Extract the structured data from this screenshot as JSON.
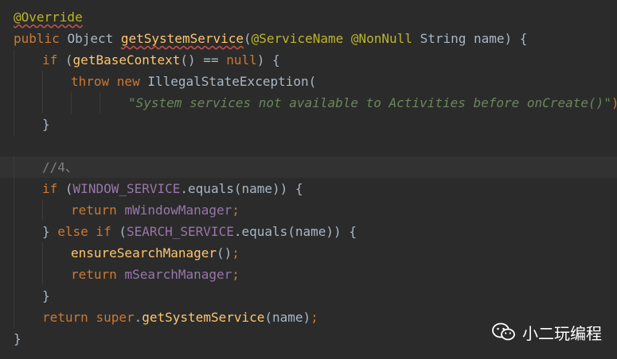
{
  "editor": {
    "lines": [
      {
        "tokens": [
          {
            "t": "@Override",
            "c": "t-annot warn"
          }
        ]
      },
      {
        "tokens": [
          {
            "t": "public ",
            "c": "t-kw"
          },
          {
            "t": "Object "
          },
          {
            "t": "getSystemService",
            "c": "t-method warn"
          },
          {
            "t": "("
          },
          {
            "t": "@ServiceName ",
            "c": "t-annot"
          },
          {
            "t": "@NonNull ",
            "c": "t-annot"
          },
          {
            "t": "String name) {"
          }
        ]
      },
      {
        "indent": 1,
        "tokens": [
          {
            "t": "if ",
            "c": "t-kw"
          },
          {
            "t": "("
          },
          {
            "t": "getBaseContext",
            "c": "t-method"
          },
          {
            "t": "() == "
          },
          {
            "t": "null",
            "c": "t-null"
          },
          {
            "t": ") {"
          }
        ]
      },
      {
        "indent": 2,
        "tokens": [
          {
            "t": "throw new ",
            "c": "t-kw"
          },
          {
            "t": "IllegalStateException("
          }
        ]
      },
      {
        "indent": 4,
        "tokens": [
          {
            "t": "\"System services not available to Activities before onCreate()\"",
            "c": "t-str"
          },
          {
            "t": ");",
            "c": "t-kw"
          }
        ]
      },
      {
        "indent": 1,
        "tokens": [
          {
            "t": "}"
          }
        ]
      },
      {
        "tokens": []
      },
      {
        "indent": 1,
        "current": true,
        "tokens": [
          {
            "t": "//4、",
            "c": "t-comment"
          }
        ]
      },
      {
        "indent": 1,
        "tokens": [
          {
            "t": "if ",
            "c": "t-kw"
          },
          {
            "t": "("
          },
          {
            "t": "WINDOW_SERVICE",
            "c": "t-field"
          },
          {
            "t": ".equals(name)) {"
          }
        ]
      },
      {
        "indent": 2,
        "tokens": [
          {
            "t": "return ",
            "c": "t-kw"
          },
          {
            "t": "mWindowManager",
            "c": "t-field"
          },
          {
            "t": ";",
            "c": "t-kw"
          }
        ]
      },
      {
        "indent": 1,
        "tokens": [
          {
            "t": "} "
          },
          {
            "t": "else if ",
            "c": "t-kw"
          },
          {
            "t": "("
          },
          {
            "t": "SEARCH_SERVICE",
            "c": "t-field"
          },
          {
            "t": ".equals(name)) {"
          }
        ]
      },
      {
        "indent": 2,
        "tokens": [
          {
            "t": "ensureSearchManager",
            "c": "t-method"
          },
          {
            "t": "()"
          },
          {
            "t": ";",
            "c": "t-kw"
          }
        ]
      },
      {
        "indent": 2,
        "tokens": [
          {
            "t": "return ",
            "c": "t-kw"
          },
          {
            "t": "mSearchManager",
            "c": "t-field"
          },
          {
            "t": ";",
            "c": "t-kw"
          }
        ]
      },
      {
        "indent": 1,
        "tokens": [
          {
            "t": "}"
          }
        ]
      },
      {
        "indent": 1,
        "tokens": [
          {
            "t": "return ",
            "c": "t-kw"
          },
          {
            "t": "super",
            "c": "t-kw"
          },
          {
            "t": "."
          },
          {
            "t": "getSystemService",
            "c": "t-method"
          },
          {
            "t": "(name)"
          },
          {
            "t": ";",
            "c": "t-kw"
          }
        ]
      },
      {
        "tokens": [
          {
            "t": "}"
          }
        ]
      }
    ]
  },
  "watermark": {
    "icon": "wechat-icon",
    "text": "小二玩编程",
    "icon_color": "#ffffff"
  },
  "colors": {
    "background": "#2b2b2b",
    "current_line": "#323232",
    "keyword": "#cc7832",
    "annotation": "#bbb529",
    "method": "#ffc66d",
    "string": "#6a8759",
    "field": "#9876aa",
    "comment": "#808080",
    "default": "#a9b7c6"
  }
}
